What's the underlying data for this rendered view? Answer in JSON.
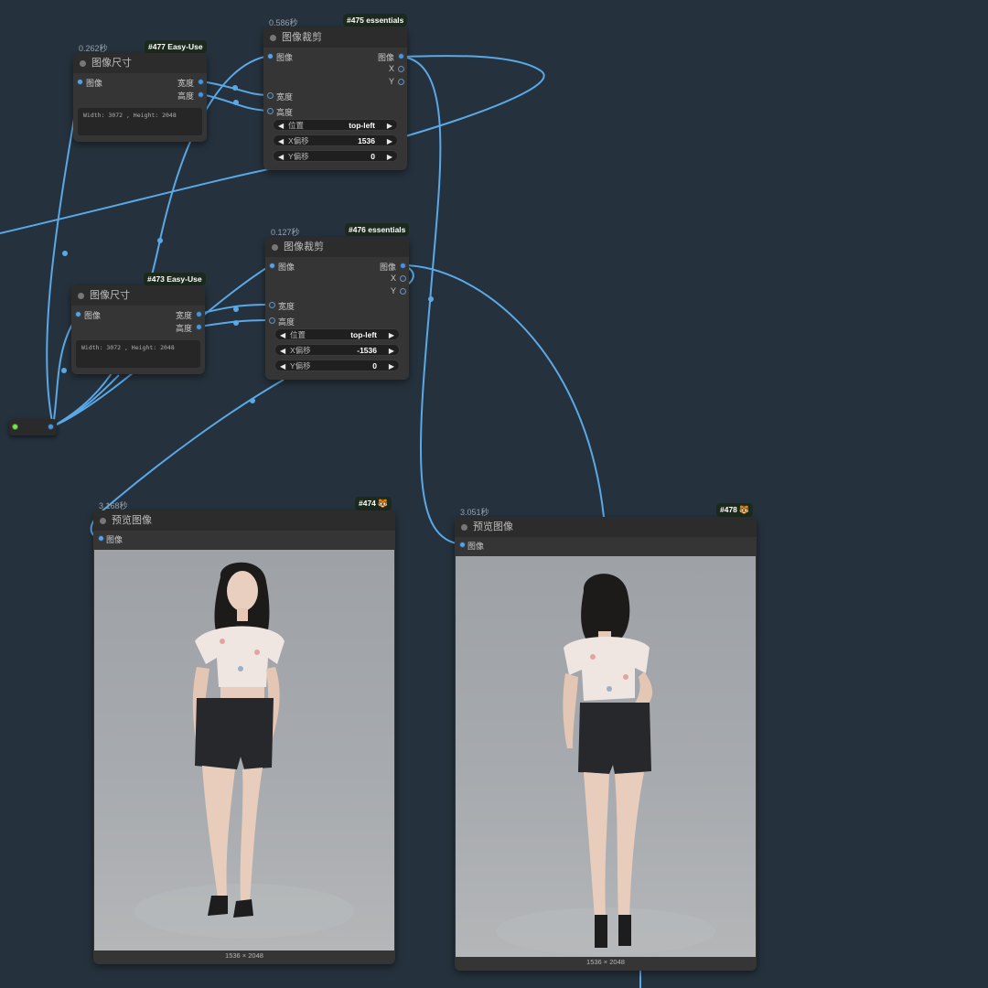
{
  "nodes": {
    "n477": {
      "timing": "0.262秒",
      "badge": "#477 Easy-Use",
      "title": "图像尺寸",
      "input": "图像",
      "outputs": [
        "宽度",
        "高度"
      ],
      "info": "Width: 3072 , Height: 2048"
    },
    "n473": {
      "badge": "#473 Easy-Use",
      "title": "图像尺寸",
      "input": "图像",
      "outputs": [
        "宽度",
        "高度"
      ],
      "info": "Width: 3072 , Height: 2048"
    },
    "n475": {
      "timing": "0.586秒",
      "badge": "#475 essentials",
      "title": "图像裁剪",
      "inputs": [
        "图像",
        "宽度",
        "高度"
      ],
      "outputs": [
        "图像",
        "X",
        "Y"
      ],
      "widgets": [
        {
          "label": "位置",
          "value": "top-left"
        },
        {
          "label": "X偏移",
          "value": "1536"
        },
        {
          "label": "Y偏移",
          "value": "0"
        }
      ]
    },
    "n476": {
      "timing": "0.127秒",
      "badge": "#476 essentials",
      "title": "图像裁剪",
      "inputs": [
        "图像",
        "宽度",
        "高度"
      ],
      "outputs": [
        "图像",
        "X",
        "Y"
      ],
      "widgets": [
        {
          "label": "位置",
          "value": "top-left"
        },
        {
          "label": "X偏移",
          "value": "-1536"
        },
        {
          "label": "Y偏移",
          "value": "0"
        }
      ]
    },
    "n474": {
      "timing": "3.168秒",
      "badge": "#474 🐯",
      "title": "预览图像",
      "input": "图像",
      "caption": "1536 × 2048"
    },
    "n478": {
      "timing": "3.051秒",
      "badge": "#478 🐯",
      "title": "预览图像",
      "input": "图像",
      "caption": "1536 × 2048"
    }
  },
  "colors": {
    "canvas": "#25313c",
    "link": "#5aa9e6",
    "node_body": "#353535",
    "badge_bg": "#1c2a1e"
  }
}
